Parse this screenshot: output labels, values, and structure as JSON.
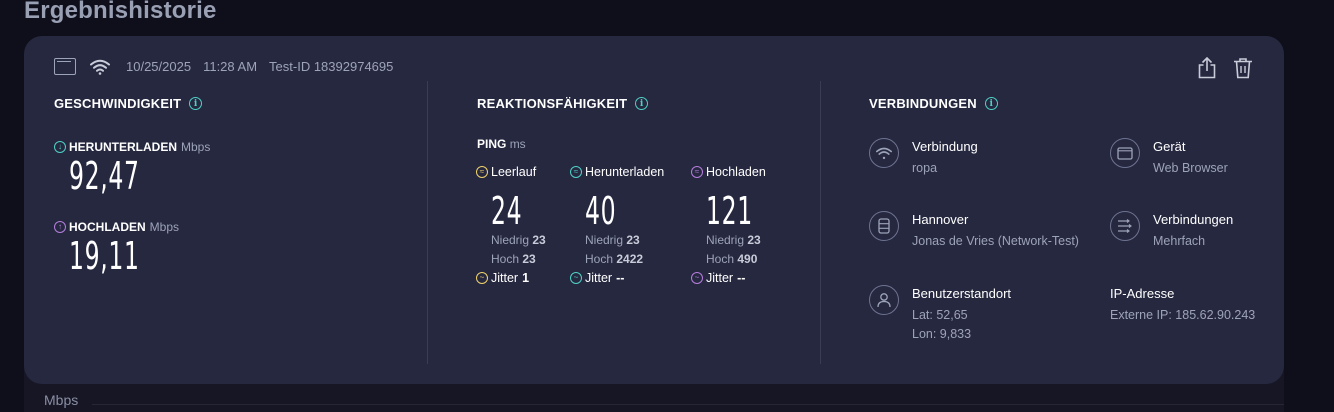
{
  "page": {
    "title": "Ergebnishistorie"
  },
  "meta": {
    "date": "10/25/2025",
    "time": "11:28 AM",
    "test_id": "Test-ID 18392974695"
  },
  "speed": {
    "title": "GESCHWINDIGKEIT",
    "download": {
      "label": "HERUNTERLADEN",
      "unit": "Mbps",
      "value": "92,47"
    },
    "upload": {
      "label": "HOCHLADEN",
      "unit": "Mbps",
      "value": "19,11"
    }
  },
  "responsiveness": {
    "title": "REAKTIONSFÄHIGKEIT",
    "ping_label": "PING",
    "ping_unit": "ms",
    "idle": {
      "label": "Leerlauf",
      "value": "24",
      "low_label": "Niedrig",
      "low": "23",
      "high_label": "Hoch",
      "high": "23",
      "jitter_label": "Jitter",
      "jitter": "1"
    },
    "download": {
      "label": "Herunterladen",
      "value": "40",
      "low_label": "Niedrig",
      "low": "23",
      "high_label": "Hoch",
      "high": "2422",
      "jitter_label": "Jitter",
      "jitter": "--"
    },
    "upload": {
      "label": "Hochladen",
      "value": "121",
      "low_label": "Niedrig",
      "low": "23",
      "high_label": "Hoch",
      "high": "490",
      "jitter_label": "Jitter",
      "jitter": "--"
    }
  },
  "connections": {
    "title": "VERBINDUNGEN",
    "connection": {
      "title": "Verbindung",
      "value": "ropa"
    },
    "device": {
      "title": "Gerät",
      "value": "Web Browser"
    },
    "server": {
      "title": "Hannover",
      "value": "Jonas de Vries (Network-Test)"
    },
    "connections": {
      "title": "Verbindungen",
      "value": "Mehrfach"
    },
    "user_location": {
      "title": "Benutzerstandort",
      "lat": "Lat: 52,65",
      "lon": "Lon: 9,833"
    },
    "ip": {
      "title": "IP-Adresse",
      "value": "Externe IP: 185.62.90.243"
    }
  },
  "bottom": {
    "unit_label": "Mbps"
  },
  "colors": {
    "download": "#4fd1c5",
    "upload": "#b57edc",
    "idle": "#f0d26a",
    "card": "#262840"
  },
  "icons": [
    "window-icon",
    "wifi-icon",
    "share-icon",
    "trash-icon",
    "info-icon",
    "download-icon",
    "upload-icon",
    "server-icon",
    "multi-connection-icon",
    "user-icon",
    "browser-icon"
  ]
}
